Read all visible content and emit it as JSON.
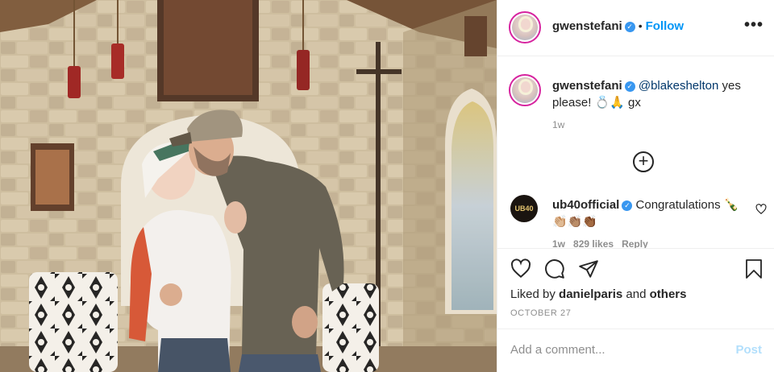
{
  "header": {
    "username": "gwenstefani",
    "follow_label": "Follow",
    "more_label": "•••"
  },
  "caption": {
    "username": "gwenstefani",
    "mention": "@blakeshelton",
    "text": " yes please! 💍🙏 gx",
    "time": "1w"
  },
  "comments": [
    {
      "username": "ub40official",
      "text": " Congratulations 🍾 👏🏼👏🏽👏🏾",
      "time": "1w",
      "likes": "829 likes",
      "reply_label": "Reply",
      "avatar_text": "UB40"
    }
  ],
  "liked_by": {
    "prefix": "Liked by ",
    "user": "danielparis",
    "middle": " and ",
    "others": "others"
  },
  "date": "OCTOBER 27",
  "comment_box": {
    "placeholder": "Add a comment...",
    "post_label": "Post"
  },
  "icons": {
    "verified": "verified-badge-icon",
    "like": "heart-icon",
    "comment": "comment-icon",
    "share": "paper-plane-icon",
    "save": "bookmark-icon",
    "load_more": "plus-circle-icon"
  },
  "colors": {
    "accent": "#0095f6",
    "verified": "#3897f0",
    "post_disabled": "#b2dffc",
    "muted": "#8e8e8e"
  }
}
